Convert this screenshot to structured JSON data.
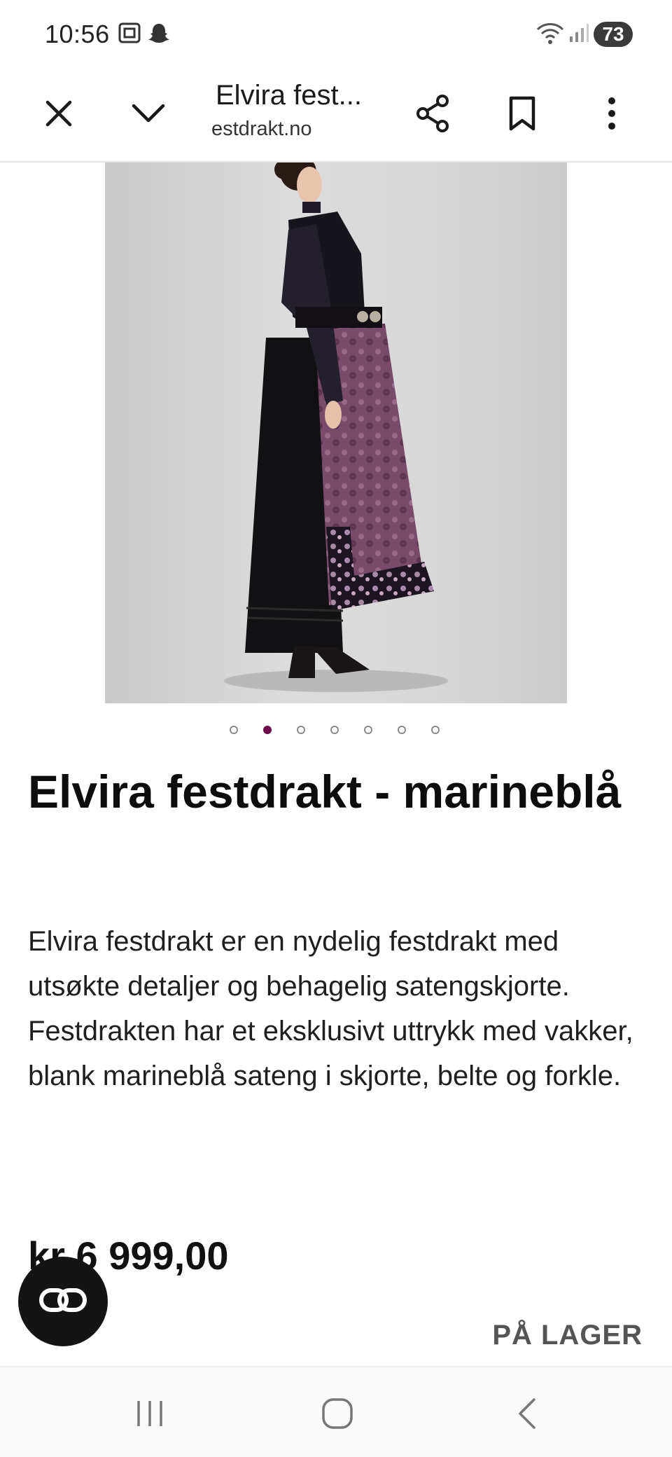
{
  "status_bar": {
    "time": "10:56",
    "battery": "73",
    "icons": [
      "screenshot-icon",
      "snapchat-icon",
      "wifi-icon",
      "signal-icon"
    ]
  },
  "toolbar": {
    "title": "Elvira fest...",
    "url": "estdrakt.no",
    "icons": [
      "close-icon",
      "chevron-down-icon",
      "share-icon",
      "bookmark-icon",
      "more-icon"
    ]
  },
  "product": {
    "image_alt": "Elvira festdrakt",
    "carousel": {
      "count": 7,
      "active_index": 1
    },
    "title": "Elvira festdrakt - marineblå",
    "description": "Elvira festdrakt er en nydelig festdrakt med utsøkte detaljer og behagelig satengskjorte. Festdrakten har et eksklusivt uttrykk med vakker, blank marineblå sateng i skjorte, belte og forkle.",
    "price": "kr 6 999,00",
    "stock": "PÅ LAGER"
  },
  "colors": {
    "accent": "#6b0b4c",
    "fab": "#141414"
  },
  "fab": {
    "icon": "link-icon"
  },
  "nav_bar": {
    "icons": [
      "recents-icon",
      "home-icon",
      "back-icon"
    ]
  }
}
